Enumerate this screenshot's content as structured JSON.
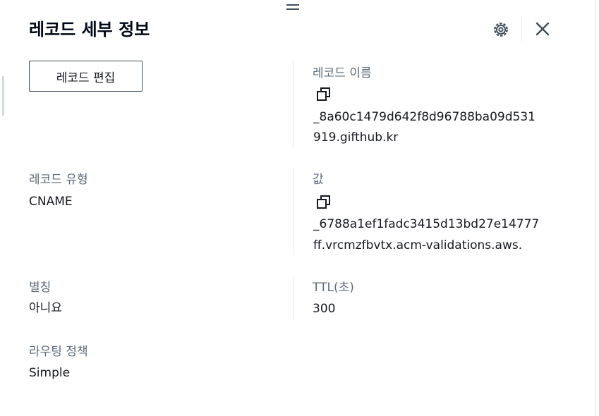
{
  "panel": {
    "title": "레코드 세부 정보",
    "edit_button_label": "레코드 편집"
  },
  "header_icons": [
    "settings-gear-icon",
    "close-icon"
  ],
  "fields": {
    "record_name": {
      "label": "레코드 이름",
      "value_line1": "_8a60c1479d642f8d96788ba09d531",
      "value_line2": "919.gifthub.kr"
    },
    "record_type": {
      "label": "레코드 유형",
      "value": "CNAME"
    },
    "value": {
      "label": "값",
      "value_line1": "_6788a1ef1fadc3415d13bd27e14777",
      "value_line2": "ff.vrcmzfbvtx.acm-validations.aws."
    },
    "alias": {
      "label": "별칭",
      "value": "아니요"
    },
    "ttl": {
      "label": "TTL(초)",
      "value": "300"
    },
    "routing_policy": {
      "label": "라우팅 정책",
      "value": "Simple"
    }
  },
  "colors": {
    "text": "#16191f",
    "label": "#5f6b7a",
    "divider": "#e9ebed",
    "border": "#414d5c"
  }
}
